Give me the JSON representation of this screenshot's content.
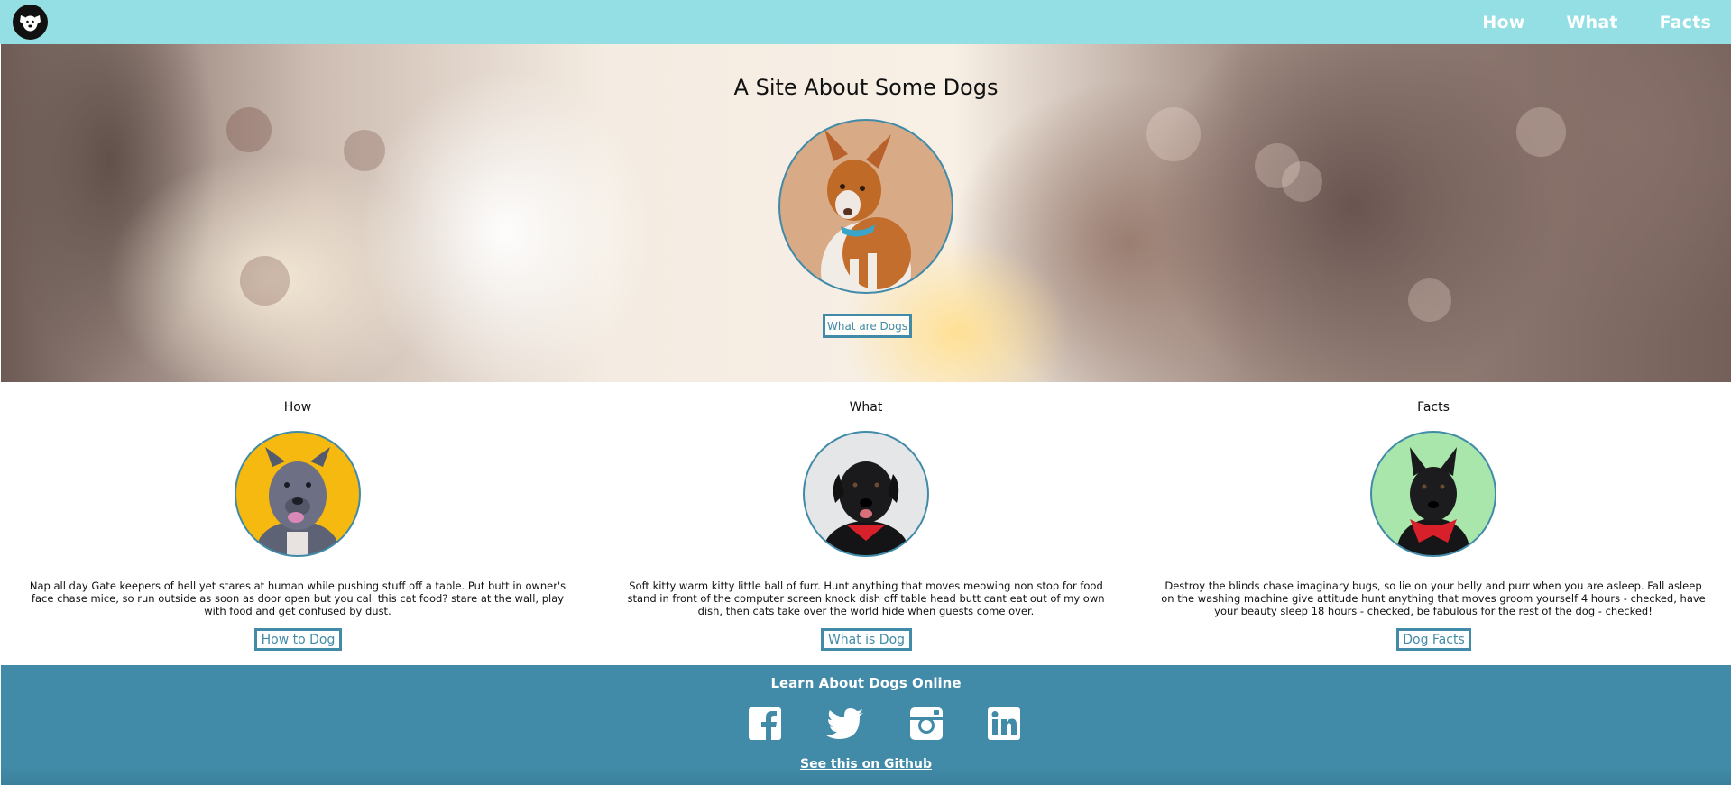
{
  "nav": {
    "logo_icon": "dog-face-icon",
    "links": [
      {
        "label": "How"
      },
      {
        "label": "What"
      },
      {
        "label": "Facts"
      }
    ]
  },
  "hero": {
    "title": "A Site About Some Dogs",
    "button_label": "What are Dogs"
  },
  "cards": [
    {
      "title": "How",
      "text": "Nap all day Gate keepers of hell yet stares at human while pushing stuff off a table. Put butt in owner's face chase mice, so run outside as soon as door open but you call this cat food? stare at the wall, play with food and get confused by dust.",
      "button_label": "How to Dog"
    },
    {
      "title": "What",
      "text": "Soft kitty warm kitty little ball of furr. Hunt anything that moves meowing non stop for food stand in front of the computer screen knock dish off table head butt cant eat out of my own dish, then cats take over the world hide when guests come over.",
      "button_label": "What is Dog"
    },
    {
      "title": "Facts",
      "text": "Destroy the blinds chase imaginary bugs, so lie on your belly and purr when you are asleep. Fall asleep on the washing machine give attitude hunt anything that moves groom yourself 4 hours - checked, have your beauty sleep 18 hours - checked, be fabulous for the rest of the dog - checked!",
      "button_label": "Dog Facts"
    }
  ],
  "footer": {
    "title": "Learn About Dogs Online",
    "social_icons": [
      "facebook-icon",
      "twitter-icon",
      "instagram-icon",
      "linkedin-icon"
    ],
    "link_label": "See this on Github"
  },
  "colors": {
    "nav_bg": "#94dfe4",
    "accent": "#418ba8",
    "footer_bg": "#418ba8"
  }
}
